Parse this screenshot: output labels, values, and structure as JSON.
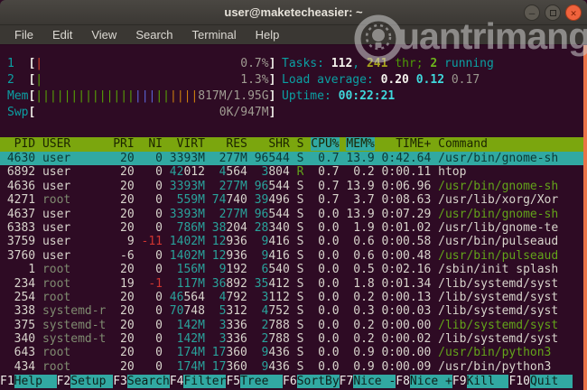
{
  "window": {
    "title": "user@maketecheasier: ~",
    "controls": {
      "minimize": "minimize",
      "maximize": "maximize",
      "close": "close"
    }
  },
  "menu": {
    "items": [
      "File",
      "Edit",
      "View",
      "Search",
      "Terminal",
      "Help"
    ]
  },
  "watermark": {
    "text": "uantrimang"
  },
  "htop": {
    "meters": [
      {
        "name": "cpu1",
        "label": "1",
        "ticks": [
          [
            1,
            "rt"
          ]
        ],
        "value": "0.7%"
      },
      {
        "name": "cpu2",
        "label": "2",
        "ticks": [
          [
            1,
            "gt"
          ]
        ],
        "value": "1.3%"
      },
      {
        "name": "mem",
        "label": "Mem",
        "ticks": [
          [
            14,
            "gt"
          ],
          [
            3,
            "bt"
          ],
          [
            2,
            "gt"
          ],
          [
            4,
            "ot"
          ]
        ],
        "value": "817M/1.95G"
      },
      {
        "name": "swp",
        "label": "Swp",
        "ticks": [],
        "value": "0K/947M"
      }
    ],
    "summary": {
      "tasks_line": [
        [
          "Tasks: ",
          "c"
        ],
        [
          "112",
          "wb"
        ],
        [
          ", ",
          "c"
        ],
        [
          "241",
          "y"
        ],
        [
          " thr; ",
          "dg"
        ],
        [
          "2",
          "bg"
        ],
        [
          " running",
          "c"
        ]
      ],
      "load_line": [
        [
          "Load average: ",
          "c"
        ],
        [
          "0.20 ",
          "wb"
        ],
        [
          "0.12 ",
          "bc"
        ],
        [
          "0.17",
          "gray"
        ]
      ],
      "uptime_line": [
        [
          "Uptime: ",
          "c"
        ],
        [
          "00:22:21",
          "bc"
        ]
      ]
    },
    "columns": [
      "PID",
      "USER",
      "PRI",
      "NI",
      "VIRT",
      "RES",
      "SHR",
      "S",
      "CPU%",
      "MEM%",
      "TIME+",
      "Command"
    ],
    "sorted_columns": [
      "CPU%",
      "MEM%"
    ],
    "rows": [
      {
        "sel": true,
        "cells": [
          "4630",
          "user",
          "20",
          "0",
          "3393M",
          "277M",
          "96544",
          "S",
          "0.7",
          "13.9",
          "0:42.64",
          "/usr/bin/gnome-sh"
        ]
      },
      {
        "cells": [
          "6892",
          "user",
          "20",
          "0",
          [
            [
              "42",
              "t"
            ],
            [
              "012",
              "w"
            ]
          ],
          [
            [
              "4",
              "t"
            ],
            [
              "564",
              "w"
            ]
          ],
          [
            [
              "3",
              "t"
            ],
            [
              "804",
              "w"
            ]
          ],
          [
            [
              "R",
              "g"
            ]
          ],
          "0.7",
          "0.2",
          "0:00.11",
          "htop"
        ]
      },
      {
        "cells": [
          "4636",
          "user",
          "20",
          "0",
          [
            [
              "3393M",
              "t"
            ]
          ],
          [
            [
              "277M",
              "t"
            ]
          ],
          [
            [
              "96",
              "t"
            ],
            [
              "544",
              "w"
            ]
          ],
          "S",
          "0.7",
          "13.9",
          "0:06.96",
          [
            [
              "/usr/bin/gnome-sh",
              "g"
            ]
          ]
        ]
      },
      {
        "cells": [
          "4271",
          [
            [
              "root",
              "dim"
            ]
          ],
          "20",
          "0",
          [
            [
              "559M",
              "t"
            ]
          ],
          [
            [
              "74",
              "t"
            ],
            [
              "740",
              "w"
            ]
          ],
          [
            [
              "39",
              "t"
            ],
            [
              "496",
              "w"
            ]
          ],
          "S",
          "0.7",
          "3.7",
          "0:08.63",
          "/usr/lib/xorg/Xor"
        ]
      },
      {
        "cells": [
          "4637",
          "user",
          "20",
          "0",
          [
            [
              "3393M",
              "t"
            ]
          ],
          [
            [
              "277M",
              "t"
            ]
          ],
          [
            [
              "96",
              "t"
            ],
            [
              "544",
              "w"
            ]
          ],
          "S",
          "0.0",
          "13.9",
          "0:07.29",
          [
            [
              "/usr/bin/gnome-sh",
              "g"
            ]
          ]
        ]
      },
      {
        "cells": [
          "6383",
          "user",
          "20",
          "0",
          [
            [
              "786M",
              "t"
            ]
          ],
          [
            [
              "38",
              "t"
            ],
            [
              "204",
              "w"
            ]
          ],
          [
            [
              "28",
              "t"
            ],
            [
              "340",
              "w"
            ]
          ],
          "S",
          "0.0",
          "1.9",
          "0:01.02",
          "/usr/lib/gnome-te"
        ]
      },
      {
        "cells": [
          "3759",
          "user",
          "9",
          [
            [
              "-11",
              "r"
            ]
          ],
          [
            [
              "1402M",
              "t"
            ]
          ],
          [
            [
              "12",
              "t"
            ],
            [
              "936",
              "w"
            ]
          ],
          [
            [
              "9",
              "t"
            ],
            [
              "416",
              "w"
            ]
          ],
          "S",
          "0.0",
          "0.6",
          "0:00.58",
          "/usr/bin/pulseaud"
        ]
      },
      {
        "cells": [
          "3760",
          "user",
          "-6",
          "0",
          [
            [
              "1402M",
              "t"
            ]
          ],
          [
            [
              "12",
              "t"
            ],
            [
              "936",
              "w"
            ]
          ],
          [
            [
              "9",
              "t"
            ],
            [
              "416",
              "w"
            ]
          ],
          "S",
          "0.0",
          "0.6",
          "0:00.48",
          [
            [
              "/usr/bin/pulseaud",
              "g"
            ]
          ]
        ]
      },
      {
        "cells": [
          "1",
          [
            [
              "root",
              "dim"
            ]
          ],
          "20",
          "0",
          [
            [
              "156M",
              "t"
            ]
          ],
          [
            [
              "9",
              "t"
            ],
            [
              "192",
              "w"
            ]
          ],
          [
            [
              "6",
              "t"
            ],
            [
              "540",
              "w"
            ]
          ],
          "S",
          "0.0",
          "0.5",
          "0:02.16",
          "/sbin/init splash"
        ]
      },
      {
        "cells": [
          "234",
          [
            [
              "root",
              "dim"
            ]
          ],
          "19",
          [
            [
              "-1",
              "r"
            ]
          ],
          [
            [
              "117M",
              "t"
            ]
          ],
          [
            [
              "36",
              "t"
            ],
            [
              "892",
              "w"
            ]
          ],
          [
            [
              "35",
              "t"
            ],
            [
              "412",
              "w"
            ]
          ],
          "S",
          "0.0",
          "1.8",
          "0:01.34",
          "/lib/systemd/syst"
        ]
      },
      {
        "cells": [
          "254",
          [
            [
              "root",
              "dim"
            ]
          ],
          "20",
          "0",
          [
            [
              "46",
              "t"
            ],
            [
              "564",
              "w"
            ]
          ],
          [
            [
              "4",
              "t"
            ],
            [
              "792",
              "w"
            ]
          ],
          [
            [
              "3",
              "t"
            ],
            [
              "112",
              "w"
            ]
          ],
          "S",
          "0.0",
          "0.2",
          "0:00.13",
          "/lib/systemd/syst"
        ]
      },
      {
        "cells": [
          "338",
          [
            [
              "systemd-r",
              "dim"
            ]
          ],
          "20",
          "0",
          [
            [
              "70",
              "t"
            ],
            [
              "748",
              "w"
            ]
          ],
          [
            [
              "5",
              "t"
            ],
            [
              "312",
              "w"
            ]
          ],
          [
            [
              "4",
              "t"
            ],
            [
              "752",
              "w"
            ]
          ],
          "S",
          "0.0",
          "0.3",
          "0:00.03",
          "/lib/systemd/syst"
        ]
      },
      {
        "cells": [
          "375",
          [
            [
              "systemd-t",
              "dim"
            ]
          ],
          "20",
          "0",
          [
            [
              "142M",
              "t"
            ]
          ],
          [
            [
              "3",
              "t"
            ],
            [
              "336",
              "w"
            ]
          ],
          [
            [
              "2",
              "t"
            ],
            [
              "788",
              "w"
            ]
          ],
          "S",
          "0.0",
          "0.2",
          "0:00.00",
          [
            [
              "/lib/systemd/syst",
              "g"
            ]
          ]
        ]
      },
      {
        "cells": [
          "340",
          [
            [
              "systemd-t",
              "dim"
            ]
          ],
          "20",
          "0",
          [
            [
              "142M",
              "t"
            ]
          ],
          [
            [
              "3",
              "t"
            ],
            [
              "336",
              "w"
            ]
          ],
          [
            [
              "2",
              "t"
            ],
            [
              "788",
              "w"
            ]
          ],
          "S",
          "0.0",
          "0.2",
          "0:00.02",
          "/lib/systemd/syst"
        ]
      },
      {
        "cells": [
          "643",
          [
            [
              "root",
              "dim"
            ]
          ],
          "20",
          "0",
          [
            [
              "174M",
              "t"
            ]
          ],
          [
            [
              "17",
              "t"
            ],
            [
              "360",
              "w"
            ]
          ],
          [
            [
              "9",
              "t"
            ],
            [
              "436",
              "w"
            ]
          ],
          "S",
          "0.0",
          "0.9",
          "0:00.00",
          [
            [
              "/usr/bin/python3",
              "g"
            ]
          ]
        ]
      },
      {
        "cells": [
          "434",
          [
            [
              "root",
              "dim"
            ]
          ],
          "20",
          "0",
          [
            [
              "174M",
              "t"
            ]
          ],
          [
            [
              "17",
              "t"
            ],
            [
              "360",
              "w"
            ]
          ],
          [
            [
              "9",
              "t"
            ],
            [
              "436",
              "w"
            ]
          ],
          "S",
          "0.0",
          "0.9",
          "0:00.09",
          "/usr/bin/python3"
        ]
      }
    ],
    "fkeys": [
      {
        "key": "F1",
        "label": "Help  "
      },
      {
        "key": "F2",
        "label": "Setup "
      },
      {
        "key": "F3",
        "label": "Search"
      },
      {
        "key": "F4",
        "label": "Filter"
      },
      {
        "key": "F5",
        "label": "Tree  "
      },
      {
        "key": "F6",
        "label": "SortBy"
      },
      {
        "key": "F7",
        "label": "Nice -"
      },
      {
        "key": "F8",
        "label": "Nice +"
      },
      {
        "key": "F9",
        "label": "Kill  "
      },
      {
        "key": "F10",
        "label": "Quit  "
      }
    ]
  },
  "colors": {
    "terminal_bg": "#2e0b24",
    "header_bg": "#7ba60e",
    "selection_bg": "#31a9a2",
    "teal_text": "#29a29b",
    "scrollbar": "#ea7348",
    "close_button": "#f0633d"
  }
}
